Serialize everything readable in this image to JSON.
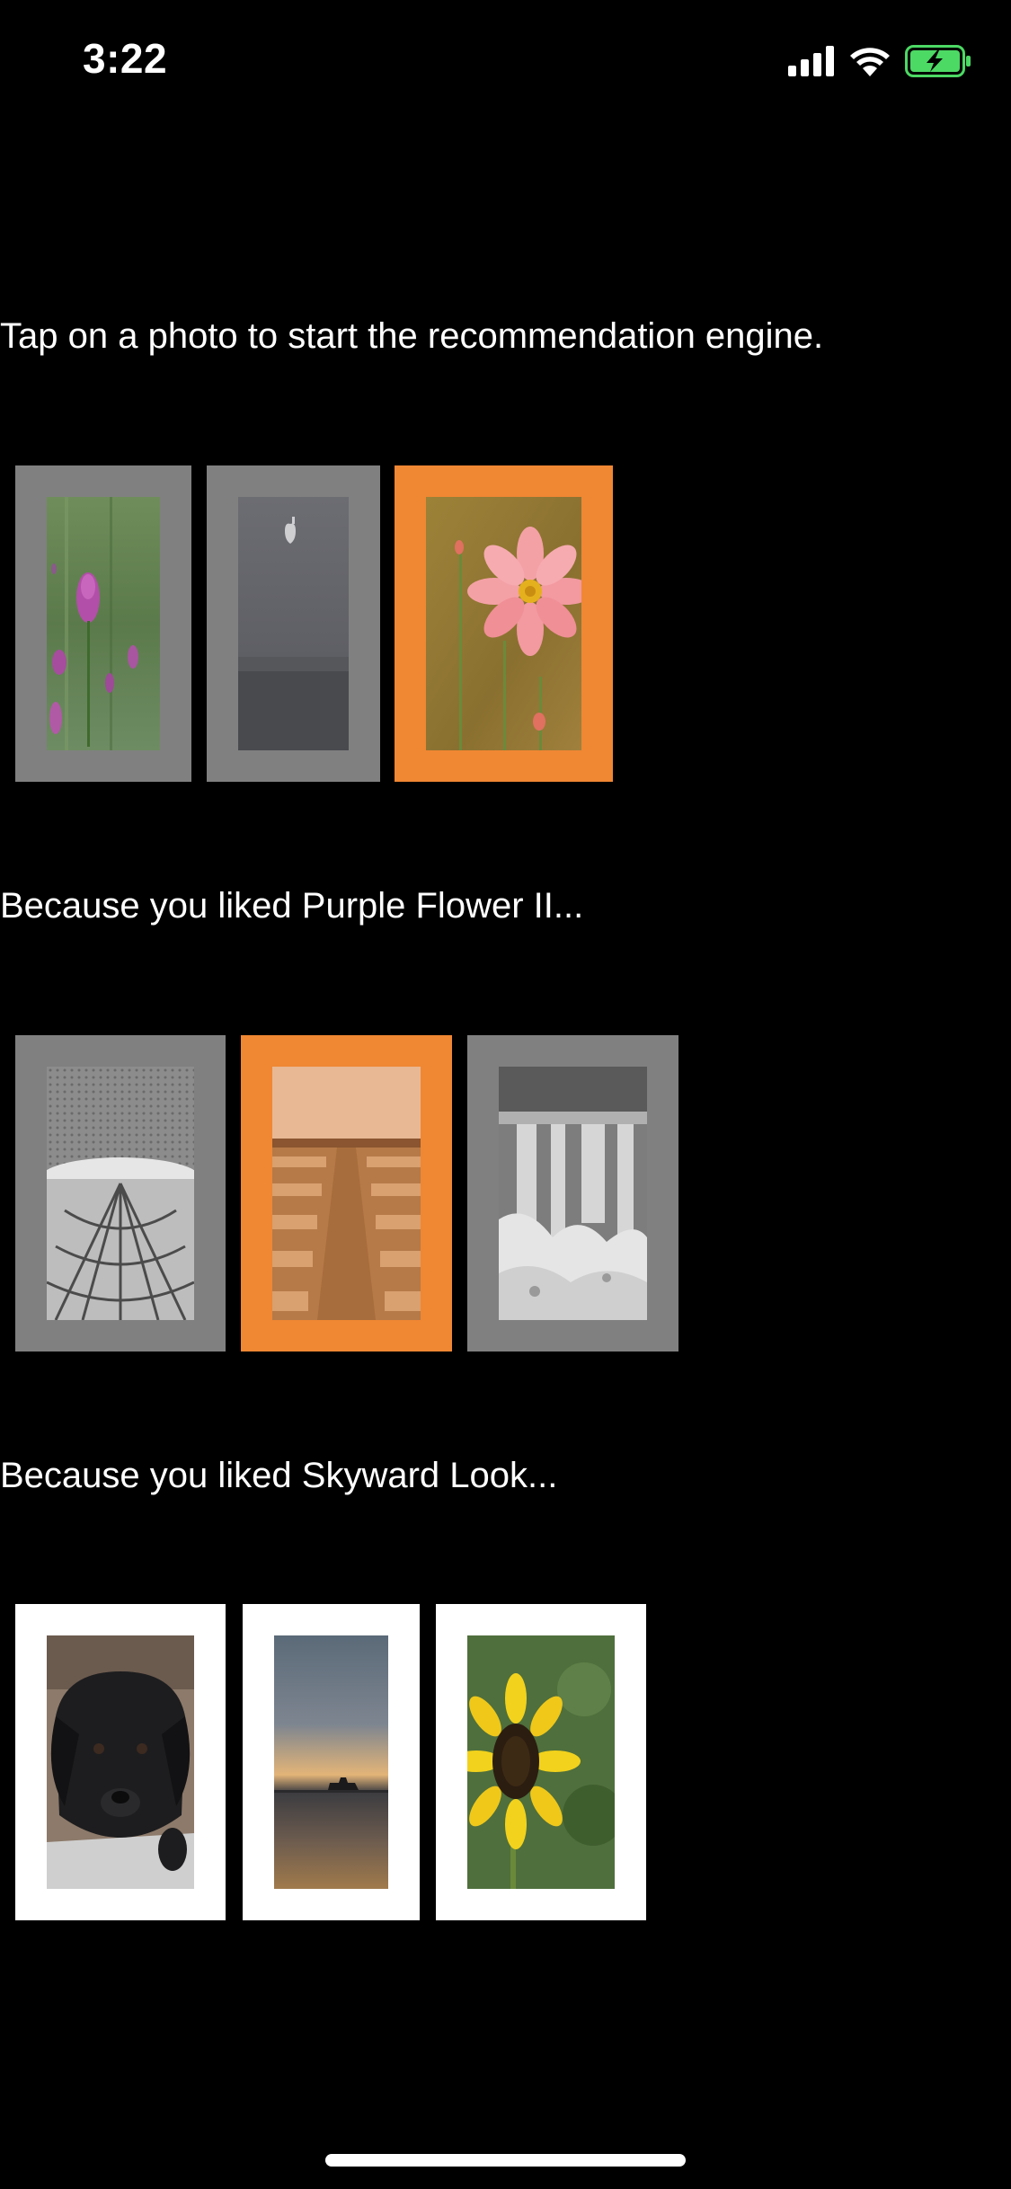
{
  "status_bar": {
    "time": "3:22",
    "icons": [
      "cellular-signal-icon",
      "wifi-icon",
      "battery-charging-icon"
    ]
  },
  "colors": {
    "background": "#000000",
    "tile_unselected": "#808080",
    "tile_selected": "#F08733",
    "tile_plain": "#FFFFFF",
    "battery_green": "#4CD964"
  },
  "sections": [
    {
      "prompt": "Tap on a photo to start the recommendation engine.",
      "photos": [
        {
          "subject": "purple clover flowers",
          "state": "unselected"
        },
        {
          "subject": "misty lake with apple logo",
          "state": "unselected"
        },
        {
          "subject": "pink cosmos flower",
          "state": "selected"
        }
      ]
    },
    {
      "prompt": "Because you liked Purple Flower II...",
      "photos": [
        {
          "subject": "ornate ceiling architecture",
          "state": "unselected"
        },
        {
          "subject": "wooden pier",
          "state": "selected"
        },
        {
          "subject": "waterfall in winter",
          "state": "unselected"
        }
      ]
    },
    {
      "prompt": "Because you liked Skyward Look...",
      "photos": [
        {
          "subject": "black labrador puppy",
          "state": "plain"
        },
        {
          "subject": "ship on sunset horizon",
          "state": "plain"
        },
        {
          "subject": "sunflower",
          "state": "plain"
        }
      ]
    }
  ]
}
